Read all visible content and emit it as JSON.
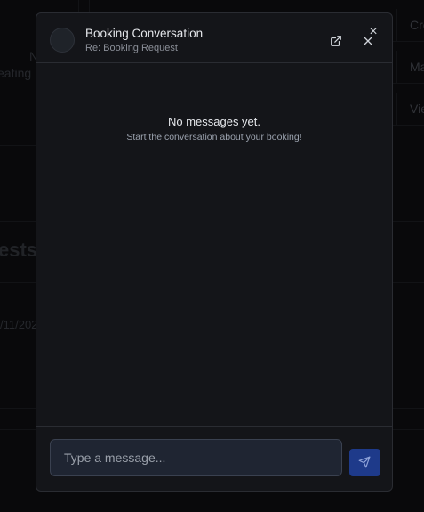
{
  "background": {
    "left_snippets": [
      "N",
      "eating"
    ],
    "heading": "ests",
    "date": "/11/202",
    "right_actions": [
      "Cre",
      "Ma",
      "Vie"
    ]
  },
  "modal": {
    "close_symbol": "×",
    "header": {
      "title": "Booking Conversation",
      "subtitle": "Re: Booking Request",
      "open_external_icon": "external-link-icon",
      "minimize_icon": "close-icon"
    },
    "empty_state": {
      "title": "No messages yet.",
      "subtitle": "Start the conversation about your booking!"
    },
    "composer": {
      "placeholder": "Type a message...",
      "send_icon": "send-icon"
    }
  },
  "colors": {
    "accent": "#1e3a8a",
    "surface": "#141519",
    "input_bg": "#1f2532"
  }
}
